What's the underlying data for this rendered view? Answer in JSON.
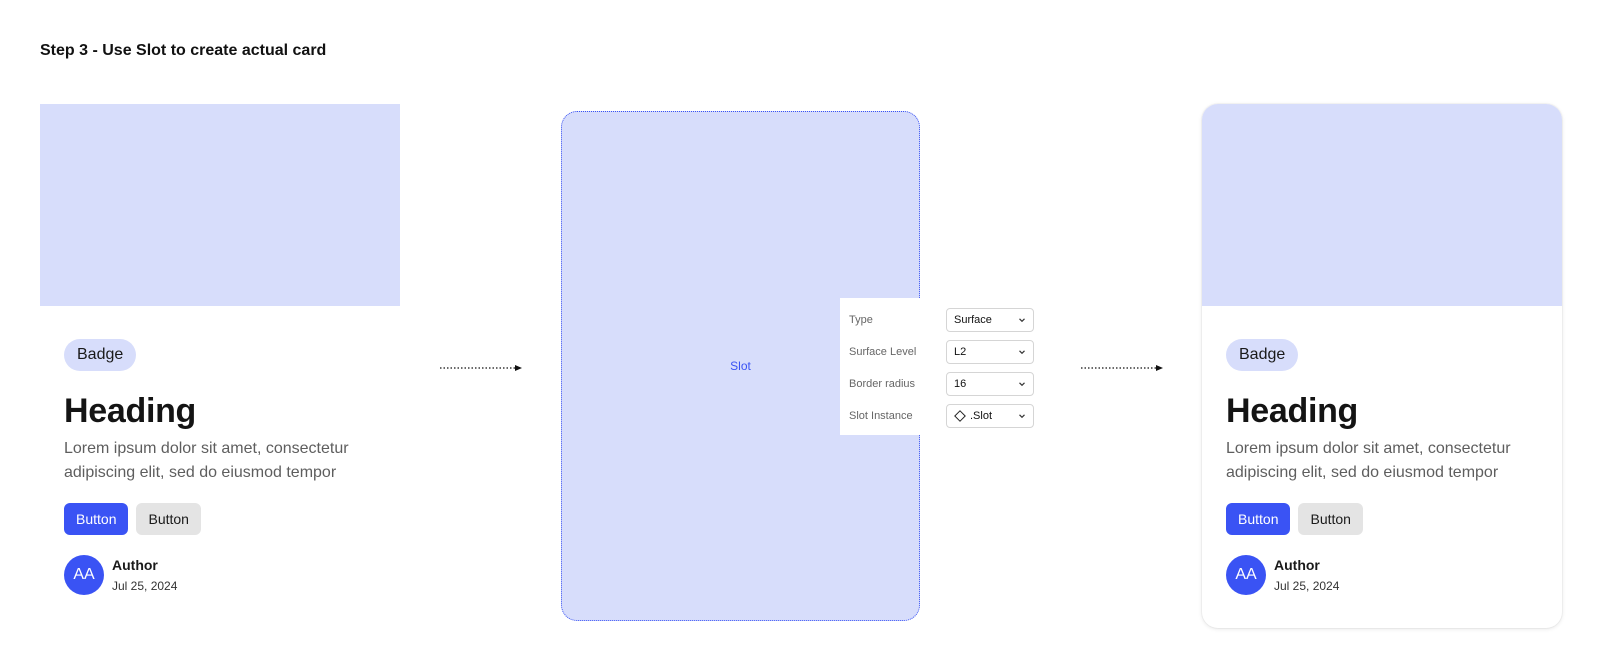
{
  "page": {
    "title": "Step 3 - Use Slot to create actual card"
  },
  "cards": {
    "left": {
      "badge": "Badge",
      "heading": "Heading",
      "description": "Lorem ipsum dolor sit amet, consectetur adipiscing elit, sed do eiusmod tempor",
      "primary_button": "Button",
      "secondary_button": "Button",
      "avatar_initials": "AA",
      "author_name": "Author",
      "author_date": "Jul 25, 2024"
    },
    "right": {
      "badge": "Badge",
      "heading": "Heading",
      "description": "Lorem ipsum dolor sit amet, consectetur adipiscing elit, sed do eiusmod tempor",
      "primary_button": "Button",
      "secondary_button": "Button",
      "avatar_initials": "AA",
      "author_name": "Author",
      "author_date": "Jul 25, 2024"
    }
  },
  "slot": {
    "label": "Slot"
  },
  "properties": {
    "type": {
      "label": "Type",
      "value": "Surface"
    },
    "surface_level": {
      "label": "Surface Level",
      "value": "L2"
    },
    "border_radius": {
      "label": "Border radius",
      "value": "16"
    },
    "slot_instance": {
      "label": "Slot Instance",
      "value": ".Slot",
      "icon": "component-diamond-icon"
    }
  },
  "colors": {
    "accent": "#3a53f4",
    "placeholder_fill": "#d7ddfb",
    "secondary_button": "#e4e4e4"
  }
}
